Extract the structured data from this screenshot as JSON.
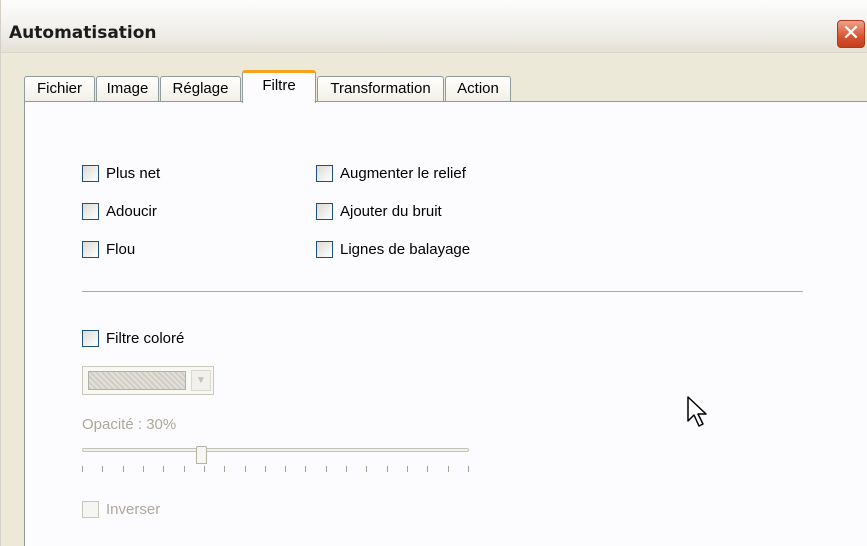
{
  "window": {
    "title": "Automatisation",
    "close_label": "✕"
  },
  "tabs": [
    {
      "label": "Fichier"
    },
    {
      "label": "Image"
    },
    {
      "label": "Réglage"
    },
    {
      "label": "Filtre",
      "active": true
    },
    {
      "label": "Transformation"
    },
    {
      "label": "Action"
    }
  ],
  "filters": {
    "left": [
      {
        "label": "Plus net",
        "checked": false
      },
      {
        "label": "Adoucir",
        "checked": false
      },
      {
        "label": "Flou",
        "checked": false
      }
    ],
    "right": [
      {
        "label": "Augmenter le relief",
        "checked": false
      },
      {
        "label": "Ajouter du bruit",
        "checked": false
      },
      {
        "label": "Lignes de balayage",
        "checked": false
      }
    ]
  },
  "color_filter": {
    "label": "Filtre coloré",
    "checked": false,
    "color_dropdown": {
      "enabled": false
    }
  },
  "opacity": {
    "label": "Opacité : 30%",
    "value_percent": 30,
    "tick_count": 20,
    "enabled": false
  },
  "invert": {
    "label": "Inverser",
    "checked": false,
    "enabled": false
  },
  "colors": {
    "active_tab_accent": "#f7a21b",
    "disabled_text": "#aca899",
    "close_button": "#d9542f"
  }
}
